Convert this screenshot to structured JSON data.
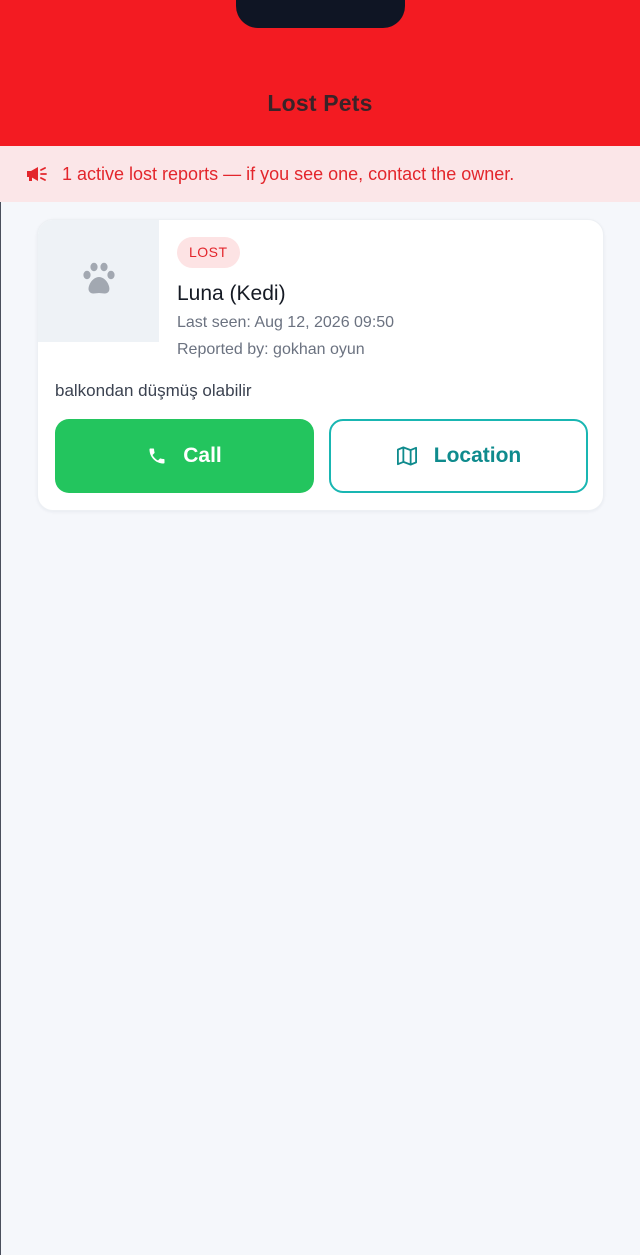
{
  "colors": {
    "header": "#f31b22",
    "banner_bg": "#fbe6e8",
    "accent_red": "#e3262c",
    "call_green": "#23c55e",
    "location_teal": "#0f8b8d"
  },
  "header": {
    "title": "Lost Pets"
  },
  "banner": {
    "icon": "megaphone-icon",
    "text": "1 active lost reports — if you see one, contact the owner."
  },
  "report": {
    "photo_icon": "paw-icon",
    "status_badge": "LOST",
    "pet_name": "Luna (Kedi)",
    "last_seen": "Last seen: Aug 12, 2026 09:50",
    "reported_by": "Reported by: gokhan oyun",
    "description": "balkondan düşmüş olabilir",
    "call_button": {
      "label": "Call",
      "icon": "phone-icon"
    },
    "location_button": {
      "label": "Location",
      "icon": "map-icon"
    }
  }
}
